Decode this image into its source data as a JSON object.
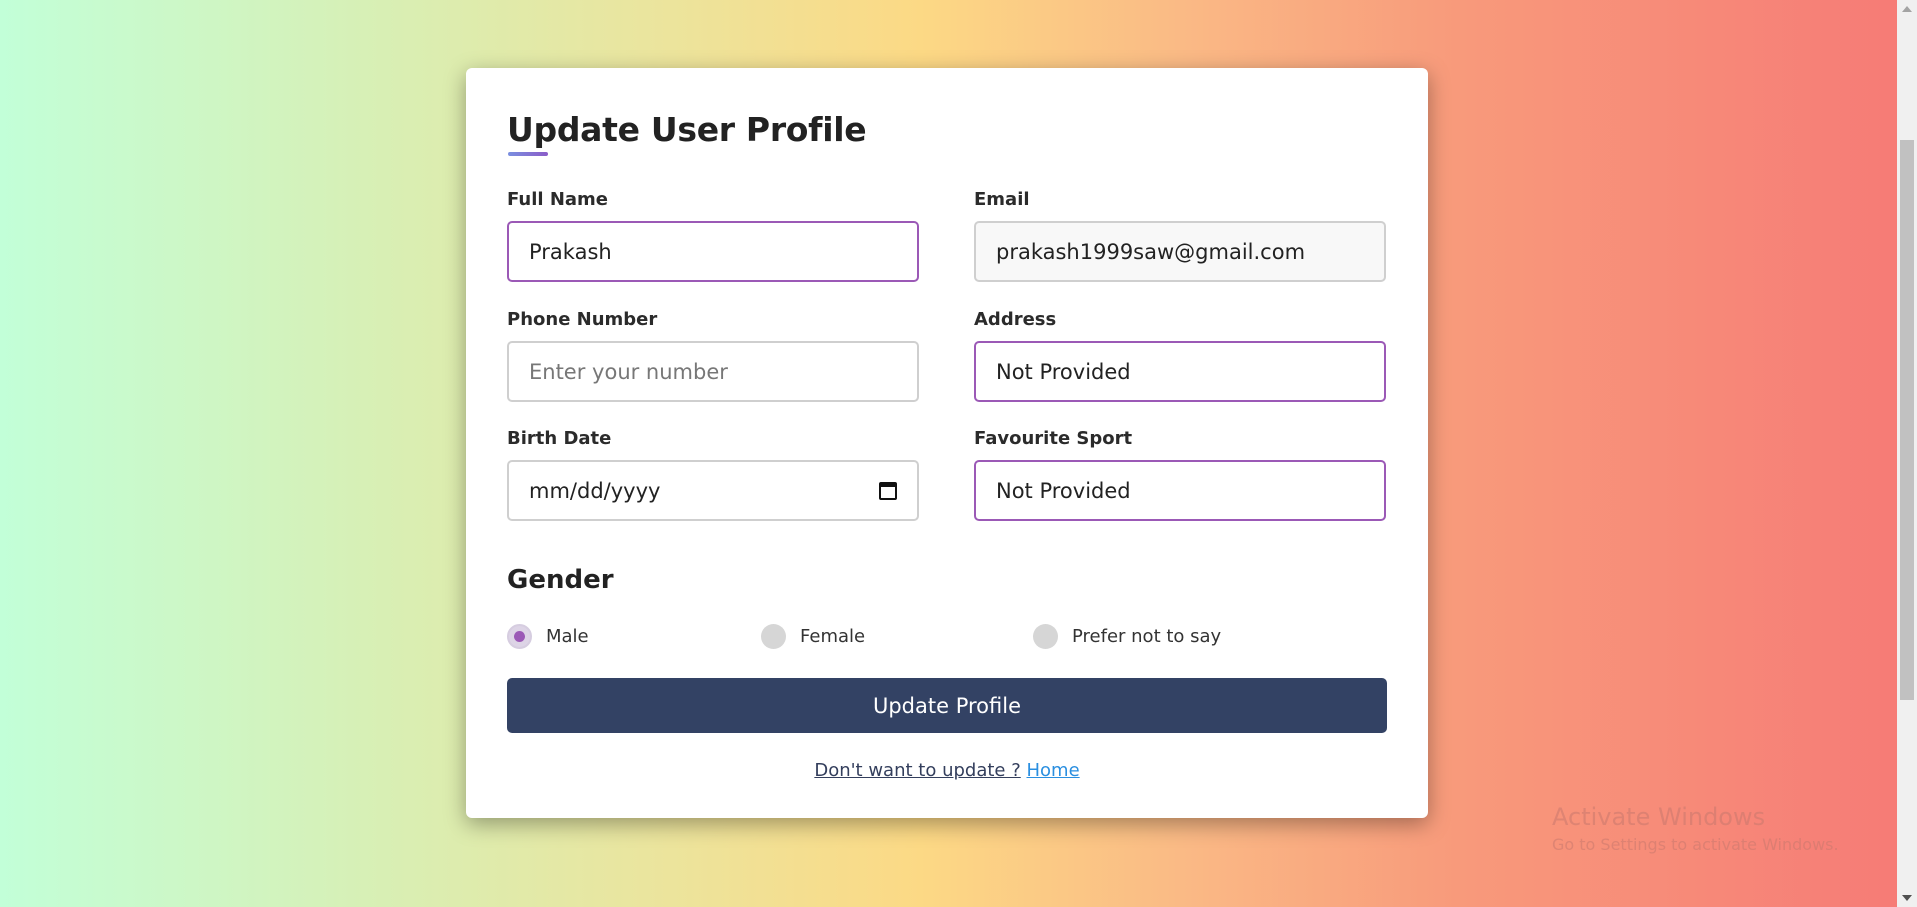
{
  "form": {
    "title": "Update User Profile",
    "full_name": {
      "label": "Full Name",
      "value": "Prakash"
    },
    "email": {
      "label": "Email",
      "value": "prakash1999saw@gmail.com"
    },
    "phone": {
      "label": "Phone Number",
      "placeholder": "Enter your number"
    },
    "address": {
      "label": "Address",
      "value": "Not Provided"
    },
    "birth_date": {
      "label": "Birth Date",
      "placeholder": "mm/dd/yyyy"
    },
    "sport": {
      "label": "Favourite Sport",
      "value": "Not Provided"
    },
    "gender": {
      "title": "Gender",
      "options": [
        "Male",
        "Female",
        "Prefer not to say"
      ],
      "selected": "Male"
    },
    "submit_label": "Update Profile",
    "footer_question": "Don't want to update ?",
    "footer_link": "Home"
  },
  "watermark": {
    "line1": "Activate Windows",
    "line2": "Go to Settings to activate Windows."
  },
  "colors": {
    "accent": "#9b59b6",
    "button": "#334264",
    "link": "#2a8fe0"
  }
}
